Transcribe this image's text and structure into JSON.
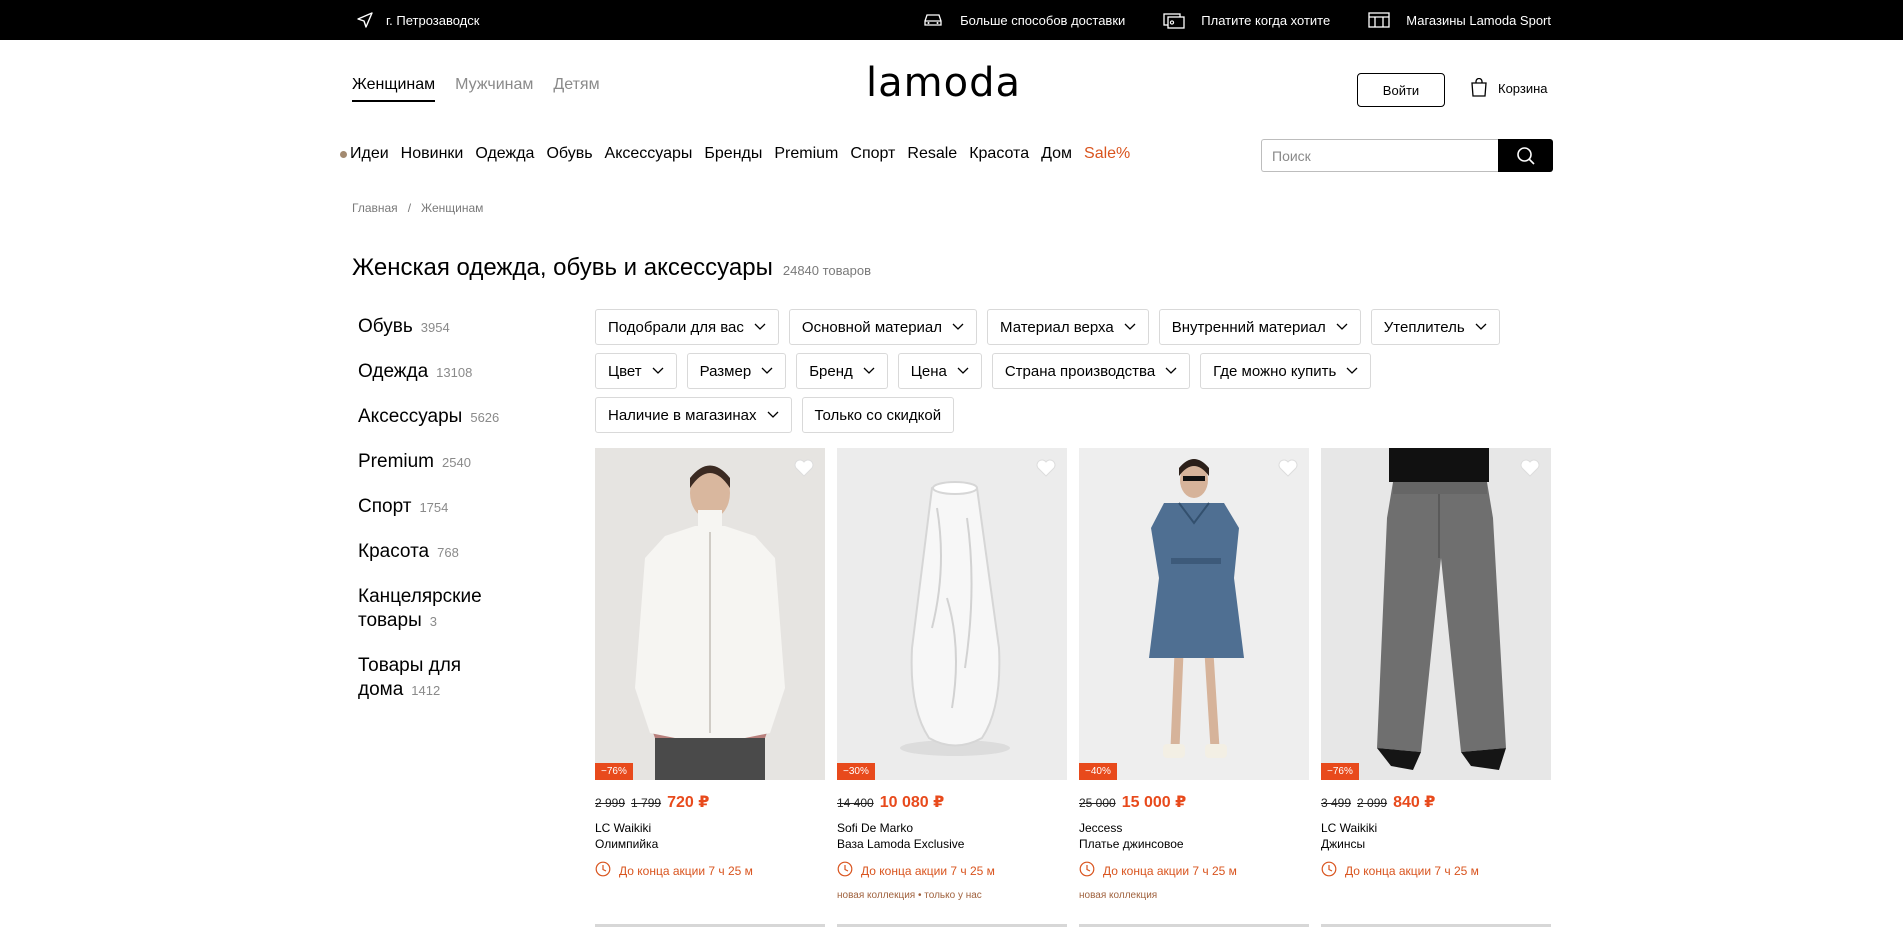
{
  "topbar": {
    "city": "г. Петрозаводск",
    "links": [
      {
        "label": "Больше способов доставки",
        "icon": "car-icon"
      },
      {
        "label": "Платите когда хотите",
        "icon": "wallet-icon"
      },
      {
        "label": "Магазины Lamoda Sport",
        "icon": "store-icon"
      }
    ]
  },
  "header": {
    "tabs": [
      "Женщинам",
      "Мужчинам",
      "Детям"
    ],
    "active_tab": "Женщинам",
    "logo": "lamoda",
    "login_label": "Войти",
    "cart_label": "Корзина"
  },
  "nav": {
    "items": [
      "Идеи",
      "Новинки",
      "Одежда",
      "Обувь",
      "Аксессуары",
      "Бренды",
      "Premium",
      "Спорт",
      "Resale",
      "Красота",
      "Дом"
    ],
    "sale": "Sale%"
  },
  "search": {
    "placeholder": "Поиск"
  },
  "breadcrumb": [
    "Главная",
    "/",
    "Женщинам"
  ],
  "page": {
    "title": "Женская одежда, обувь и аксессуары",
    "count": "24840 товаров"
  },
  "sidebar": [
    {
      "label": "Обувь",
      "count": "3954"
    },
    {
      "label": "Одежда",
      "count": "13108"
    },
    {
      "label": "Аксессуары",
      "count": "5626"
    },
    {
      "label": "Premium",
      "count": "2540"
    },
    {
      "label": "Спорт",
      "count": "1754"
    },
    {
      "label": "Красота",
      "count": "768"
    },
    {
      "label": "Канцелярские товары",
      "count": "3"
    },
    {
      "label": "Товары для дома",
      "count": "1412"
    }
  ],
  "filters": [
    {
      "label": "Подобрали для вас",
      "dropdown": true
    },
    {
      "label": "Основной материал",
      "dropdown": true
    },
    {
      "label": "Материал верха",
      "dropdown": true
    },
    {
      "label": "Внутренний материал",
      "dropdown": true
    },
    {
      "label": "Утеплитель",
      "dropdown": true
    },
    {
      "label": "Цвет",
      "dropdown": true
    },
    {
      "label": "Размер",
      "dropdown": true
    },
    {
      "label": "Бренд",
      "dropdown": true
    },
    {
      "label": "Цена",
      "dropdown": true
    },
    {
      "label": "Страна производства",
      "dropdown": true
    },
    {
      "label": "Где можно купить",
      "dropdown": true
    },
    {
      "label": "Наличие в магазинах",
      "dropdown": true
    },
    {
      "label": "Только со скидкой",
      "dropdown": false
    }
  ],
  "products": [
    {
      "badge": "−76%",
      "old_prices": [
        "2 999",
        "1 799"
      ],
      "price": "720 ₽",
      "brand": "LC Waikiki",
      "name": "Олимпийка",
      "timer": "До конца акции 7 ч 25 м",
      "tags": ""
    },
    {
      "badge": "−30%",
      "old_prices": [
        "14 400"
      ],
      "price": "10 080 ₽",
      "brand": "Sofi De Marko",
      "name": "Ваза Lamoda Exclusive",
      "timer": "До конца акции 7 ч 25 м",
      "tags": "новая коллекция • только у нас"
    },
    {
      "badge": "−40%",
      "old_prices": [
        "25 000"
      ],
      "price": "15 000 ₽",
      "brand": "Jeccess",
      "name": "Платье джинсовое",
      "timer": "До конца акции 7 ч 25 м",
      "tags": "новая коллекция"
    },
    {
      "badge": "−76%",
      "old_prices": [
        "3 499",
        "2 099"
      ],
      "price": "840 ₽",
      "brand": "LC Waikiki",
      "name": "Джинсы",
      "timer": "До конца акции 7 ч 25 м",
      "tags": ""
    }
  ],
  "colors": {
    "accent": "#e84a1c",
    "sale": "#d9541e",
    "topbar": "#000000"
  }
}
